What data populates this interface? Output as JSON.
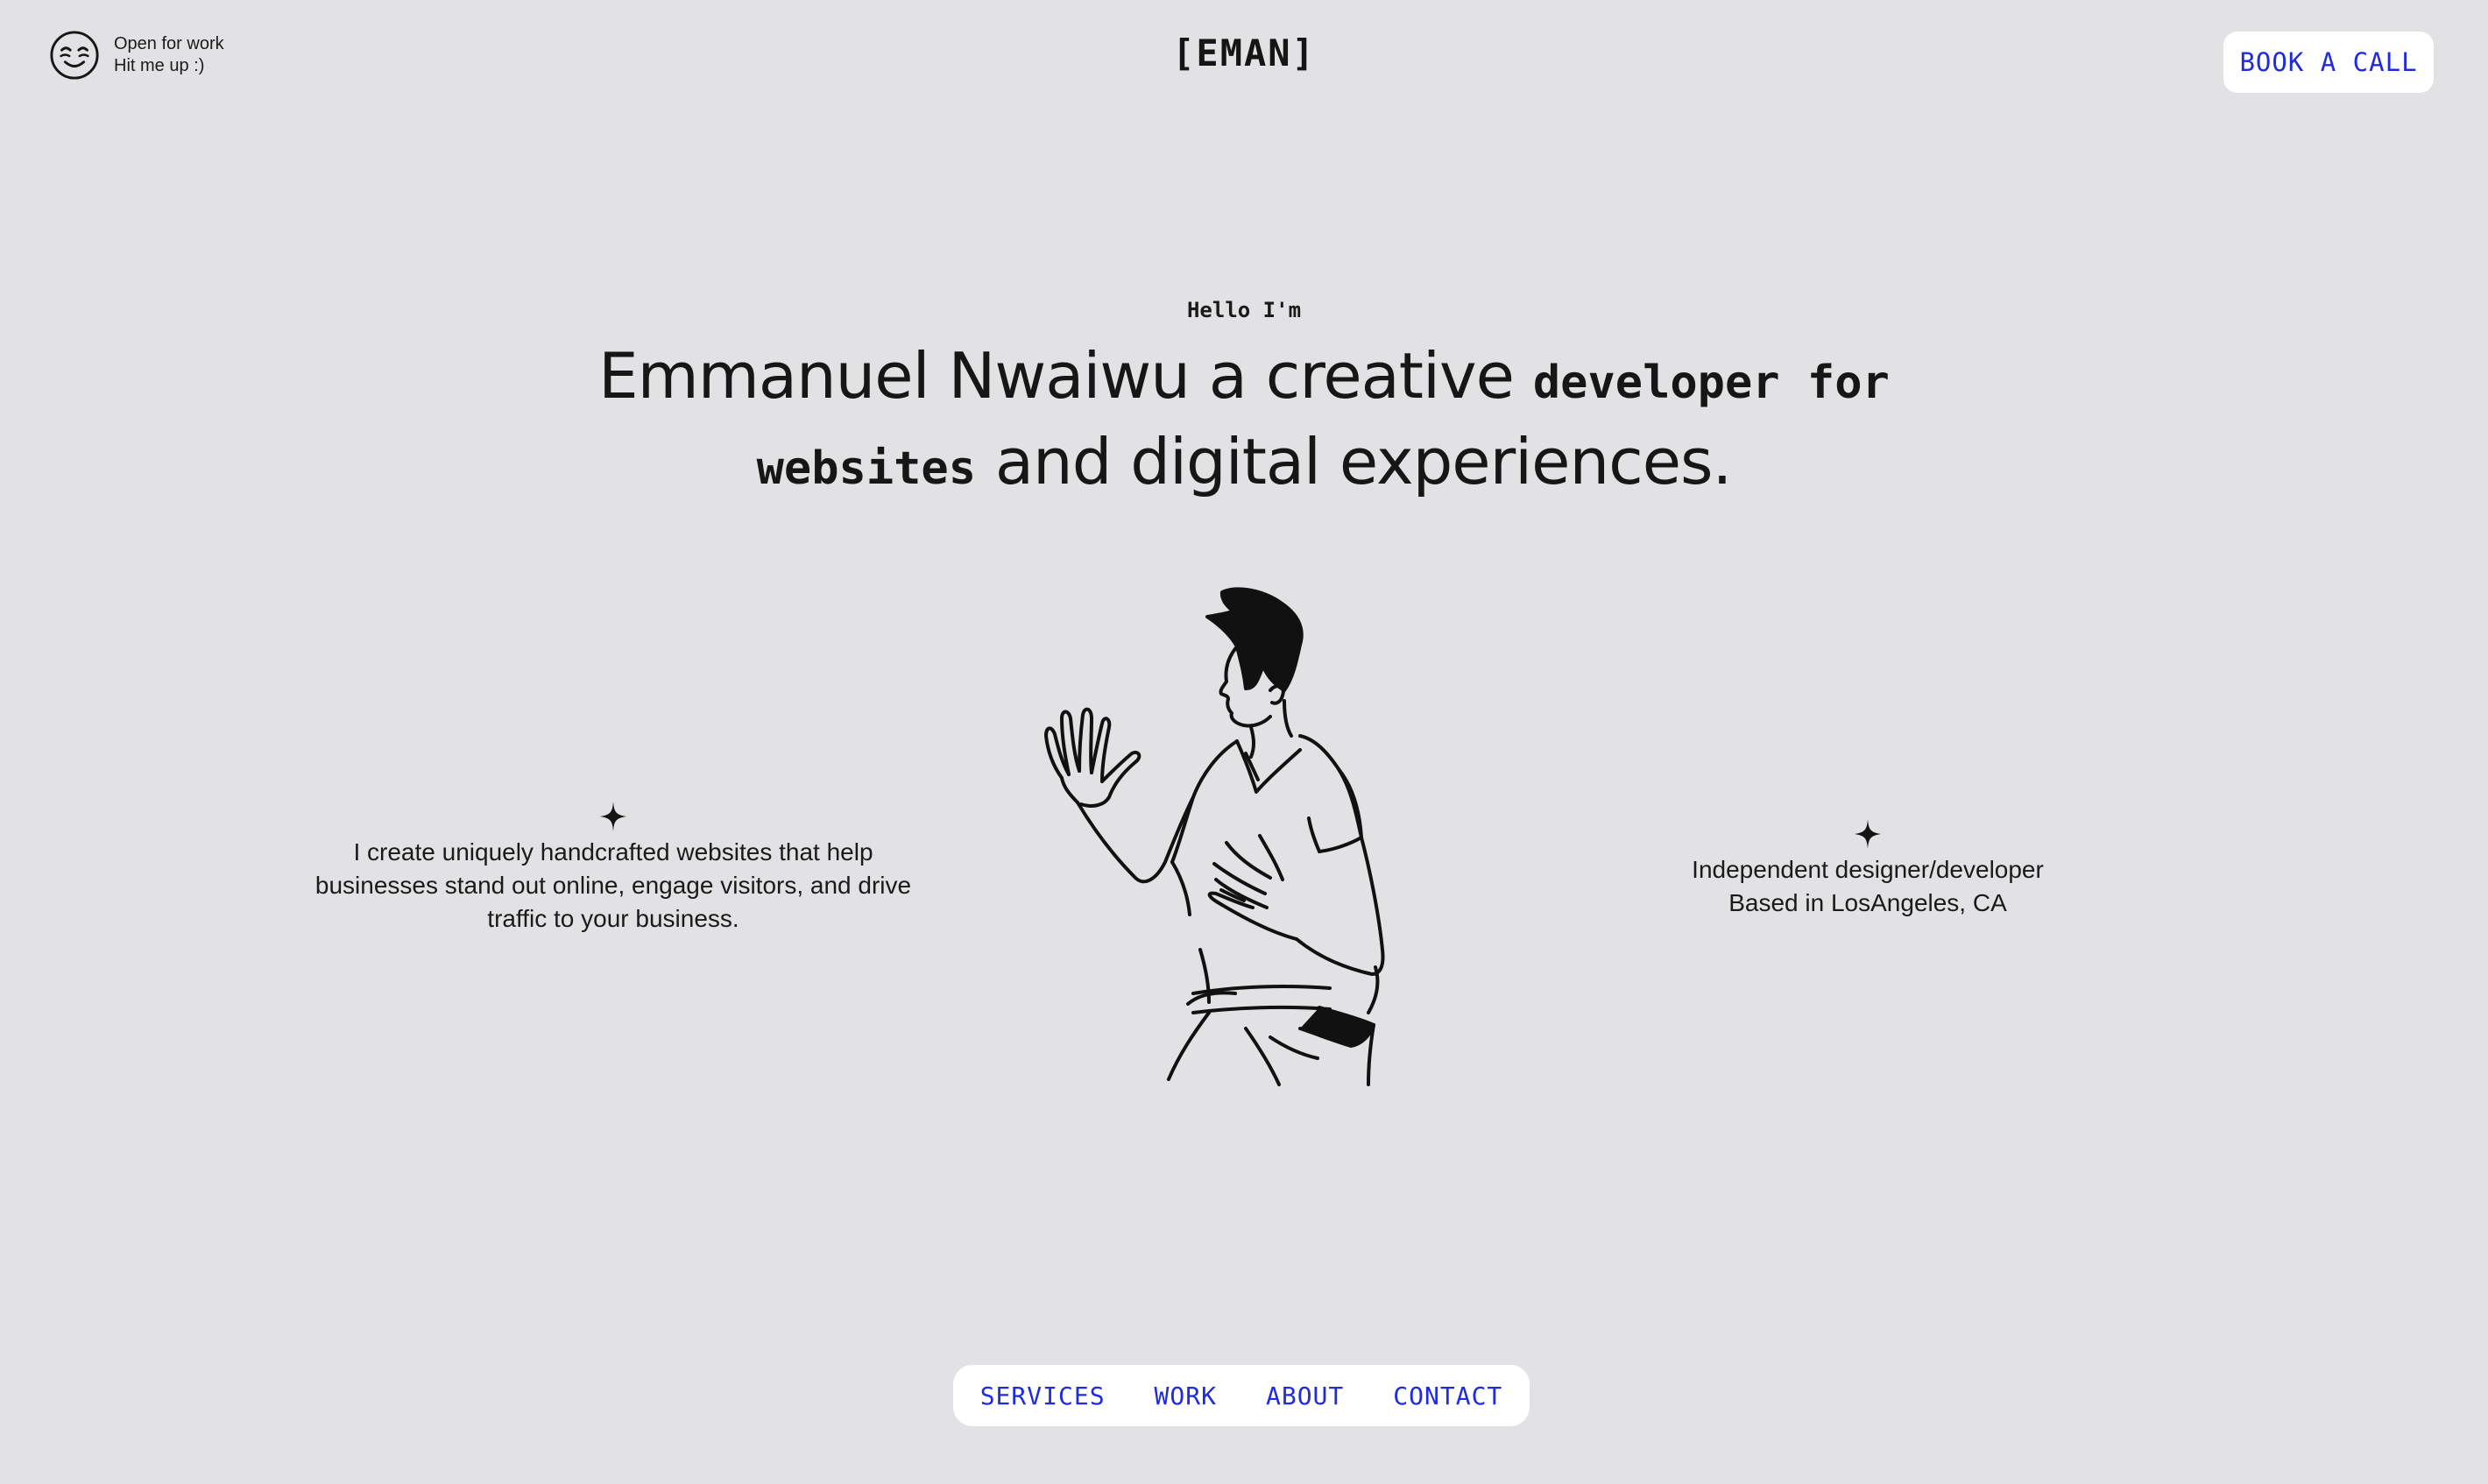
{
  "status": {
    "icon": "smiley-face-icon",
    "line1": "Open for work",
    "line2": "Hit me up :)"
  },
  "logo": "[EMAN]",
  "cta_label": "BOOK A CALL",
  "hero": {
    "greeting": "Hello I'm",
    "headline_part1": "Emmanuel Nwaiwu a creative ",
    "headline_mono": "developer for websites",
    "headline_part2": " and digital experiences."
  },
  "left_blurb": {
    "icon": "sparkle-icon",
    "text": "I create uniquely handcrafted websites that help businesses stand out online, engage visitors, and drive traffic to your business."
  },
  "right_blurb": {
    "icon": "sparkle-icon",
    "line1": "Independent designer/developer",
    "line2": "Based in LosAngeles, CA"
  },
  "nav": {
    "items": [
      {
        "label": "SERVICES"
      },
      {
        "label": "WORK"
      },
      {
        "label": "ABOUT"
      },
      {
        "label": "CONTACT"
      }
    ]
  },
  "colors": {
    "background": "#e2e2e4",
    "accent": "#1f2bdd",
    "text": "#171717",
    "surface": "#ffffff"
  }
}
